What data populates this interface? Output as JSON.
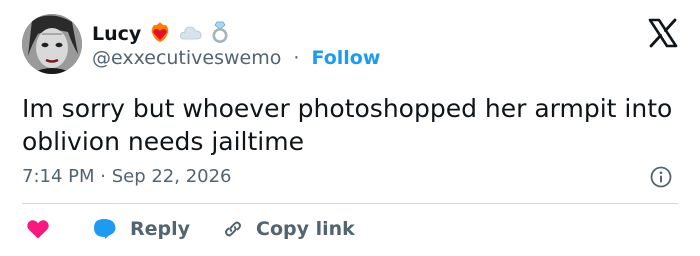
{
  "user": {
    "name": "Lucy",
    "badges": [
      "heart-on-fire-icon",
      "cloud-icon",
      "ring-icon"
    ],
    "handle": "@exxecutiveswemo",
    "separator": "·",
    "follow_label": "Follow"
  },
  "tweet": {
    "text": "Im sorry but whoever photoshopped her armpit into oblivion needs jailtime",
    "timestamp": "7:14 PM · Sep 22, 2026"
  },
  "actions": {
    "reply_label": "Reply",
    "copy_link_label": "Copy link"
  },
  "colors": {
    "accent": "#1d9bf0",
    "like": "#f91880",
    "secondary_text": "#536471",
    "primary_text": "#0f1419"
  }
}
